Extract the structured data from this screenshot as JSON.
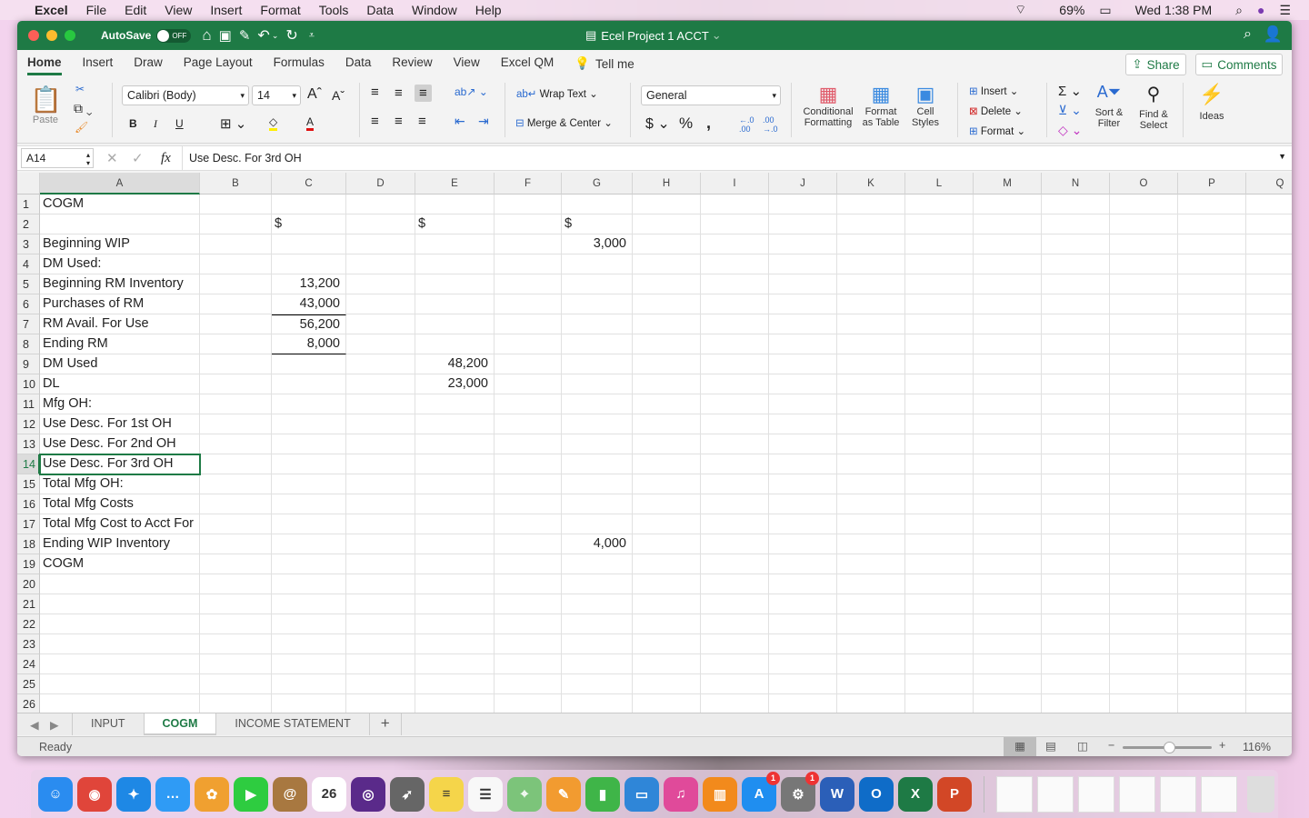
{
  "menubar": {
    "app": "Excel",
    "items": [
      "File",
      "Edit",
      "View",
      "Insert",
      "Format",
      "Tools",
      "Data",
      "Window",
      "Help"
    ],
    "battery": "69%",
    "clock": "Wed 1:38 PM"
  },
  "titlebar": {
    "autosave": "AutoSave",
    "autosave_state": "OFF",
    "title": "Ecel Project 1 ACCT"
  },
  "tabs": [
    "Home",
    "Insert",
    "Draw",
    "Page Layout",
    "Formulas",
    "Data",
    "Review",
    "View",
    "Excel QM"
  ],
  "tell_me": "Tell me",
  "share": "Share",
  "comments": "Comments",
  "ribbon": {
    "paste": "Paste",
    "font": "Calibri (Body)",
    "size": "14",
    "wrap": "Wrap Text",
    "merge": "Merge & Center",
    "number_format": "General",
    "cond1": "Conditional",
    "cond2": "Formatting",
    "fmt1": "Format",
    "fmt2": "as Table",
    "cs1": "Cell",
    "cs2": "Styles",
    "insert": "Insert",
    "delete": "Delete",
    "format": "Format",
    "sort1": "Sort &",
    "sort2": "Filter",
    "find1": "Find &",
    "find2": "Select",
    "ideas": "Ideas",
    "bold": "B",
    "italic": "I",
    "underline": "U"
  },
  "formula_bar": {
    "name_box": "A14",
    "fx": "fx",
    "formula": "Use Desc. For 3rd OH"
  },
  "columns": [
    "A",
    "B",
    "C",
    "D",
    "E",
    "F",
    "G",
    "H",
    "I",
    "J",
    "K",
    "L",
    "M",
    "N",
    "O",
    "P",
    "Q"
  ],
  "rows": [
    {
      "A": "COGM"
    },
    {
      "C": "$",
      "E": "$",
      "G": "$"
    },
    {
      "A": "Beginning WIP",
      "G": "3,000"
    },
    {
      "A": "DM Used:"
    },
    {
      "A": "Beginning RM Inventory",
      "C": "13,200"
    },
    {
      "A": "Purchases of RM",
      "C": "43,000"
    },
    {
      "A": "RM Avail. For Use",
      "C": "56,200"
    },
    {
      "A": "Ending RM",
      "C": "8,000"
    },
    {
      "A": "DM Used",
      "E": "48,200"
    },
    {
      "A": "DL",
      "E": "23,000"
    },
    {
      "A": "Mfg OH:"
    },
    {
      "A": "Use Desc. For 1st OH"
    },
    {
      "A": "Use Desc. For 2nd OH"
    },
    {
      "A": "Use Desc. For 3rd OH"
    },
    {
      "A": "Total Mfg OH:"
    },
    {
      "A": "Total Mfg Costs"
    },
    {
      "A": "Total Mfg Cost to Acct For"
    },
    {
      "A": "Ending WIP Inventory",
      "G": "4,000"
    },
    {
      "A": "COGM"
    },
    {},
    {},
    {},
    {},
    {},
    {},
    {},
    {}
  ],
  "selected_cell": "A14",
  "sheets": [
    "INPUT",
    "COGM",
    "INCOME STATEMENT"
  ],
  "active_sheet": "COGM",
  "add_sheet": "+",
  "status": {
    "text": "Ready",
    "zoom": "116%",
    "zoom_percent": 116
  },
  "dock": [
    {
      "name": "finder",
      "label": "☺",
      "color": "#2a8cf0"
    },
    {
      "name": "chrome",
      "label": "◉",
      "color": "#e0453a"
    },
    {
      "name": "safari",
      "label": "✦",
      "color": "#1e88e5"
    },
    {
      "name": "messages",
      "label": "…",
      "color": "#2f9bf5"
    },
    {
      "name": "photos",
      "label": "✿",
      "color": "#f0a030"
    },
    {
      "name": "facetime",
      "label": "▶",
      "color": "#2ecc40"
    },
    {
      "name": "contacts",
      "label": "@",
      "color": "#a87840"
    },
    {
      "name": "calendar",
      "label": "26",
      "color": "#ffffff"
    },
    {
      "name": "siri",
      "label": "◎",
      "color": "#5a2a8a"
    },
    {
      "name": "launchpad",
      "label": "➶",
      "color": "#666"
    },
    {
      "name": "notes",
      "label": "≡",
      "color": "#f5d54a"
    },
    {
      "name": "reminders",
      "label": "☰",
      "color": "#f8f8f8"
    },
    {
      "name": "maps",
      "label": "⌖",
      "color": "#7cc47a"
    },
    {
      "name": "pages",
      "label": "✎",
      "color": "#f29b30"
    },
    {
      "name": "numbers",
      "label": "▮",
      "color": "#3fb548"
    },
    {
      "name": "keynote",
      "label": "▭",
      "color": "#2f86d8"
    },
    {
      "name": "itunes",
      "label": "♫",
      "color": "#e04a9a"
    },
    {
      "name": "books",
      "label": "▥",
      "color": "#f28a1c"
    },
    {
      "name": "app-store",
      "label": "A",
      "color": "#1f8ef0",
      "badge": "1"
    },
    {
      "name": "system-preferences",
      "label": "⚙",
      "color": "#777",
      "badge": "1"
    },
    {
      "name": "word",
      "label": "W",
      "color": "#2b5fb8"
    },
    {
      "name": "outlook",
      "label": "O",
      "color": "#0f6cc8"
    },
    {
      "name": "excel",
      "label": "X",
      "color": "#1e7a45"
    },
    {
      "name": "powerpoint",
      "label": "P",
      "color": "#d24726"
    }
  ]
}
